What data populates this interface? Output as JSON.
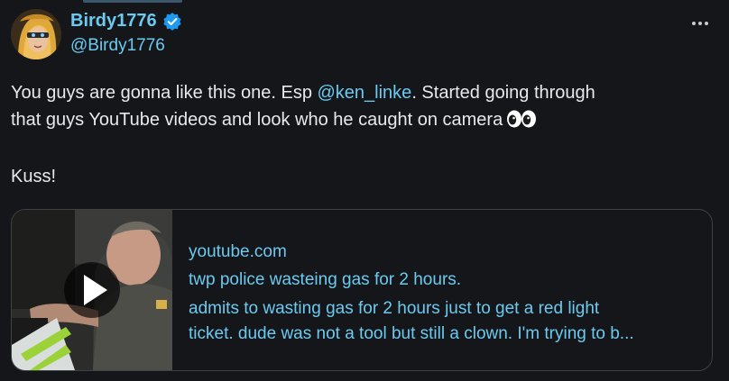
{
  "user": {
    "display_name": "Birdy1776",
    "handle": "@Birdy1776",
    "verified": true,
    "avatar_icon": "avatar-illustration"
  },
  "tweet": {
    "line1_pre": "You guys are gonna like this one. Esp ",
    "mention": "@ken_linke",
    "line1_post": ". Started going through",
    "line2": "that guys YouTube videos and look who he caught on camera",
    "emoji": "eyes-emoji",
    "line3": "Kuss!"
  },
  "card": {
    "domain": "youtube.com",
    "title": "twp police wasteing gas for 2 hours.",
    "desc_line1": "admits to wasting gas for 2 hours just to get a red light",
    "desc_line2": "ticket. dude was not a tool but still a clown. I'm trying to b...",
    "play_icon": "play-icon"
  },
  "colors": {
    "background": "#14161a",
    "accent": "#6ccaf0",
    "text": "#e7e9ea",
    "verified": "#1d9bf0"
  }
}
